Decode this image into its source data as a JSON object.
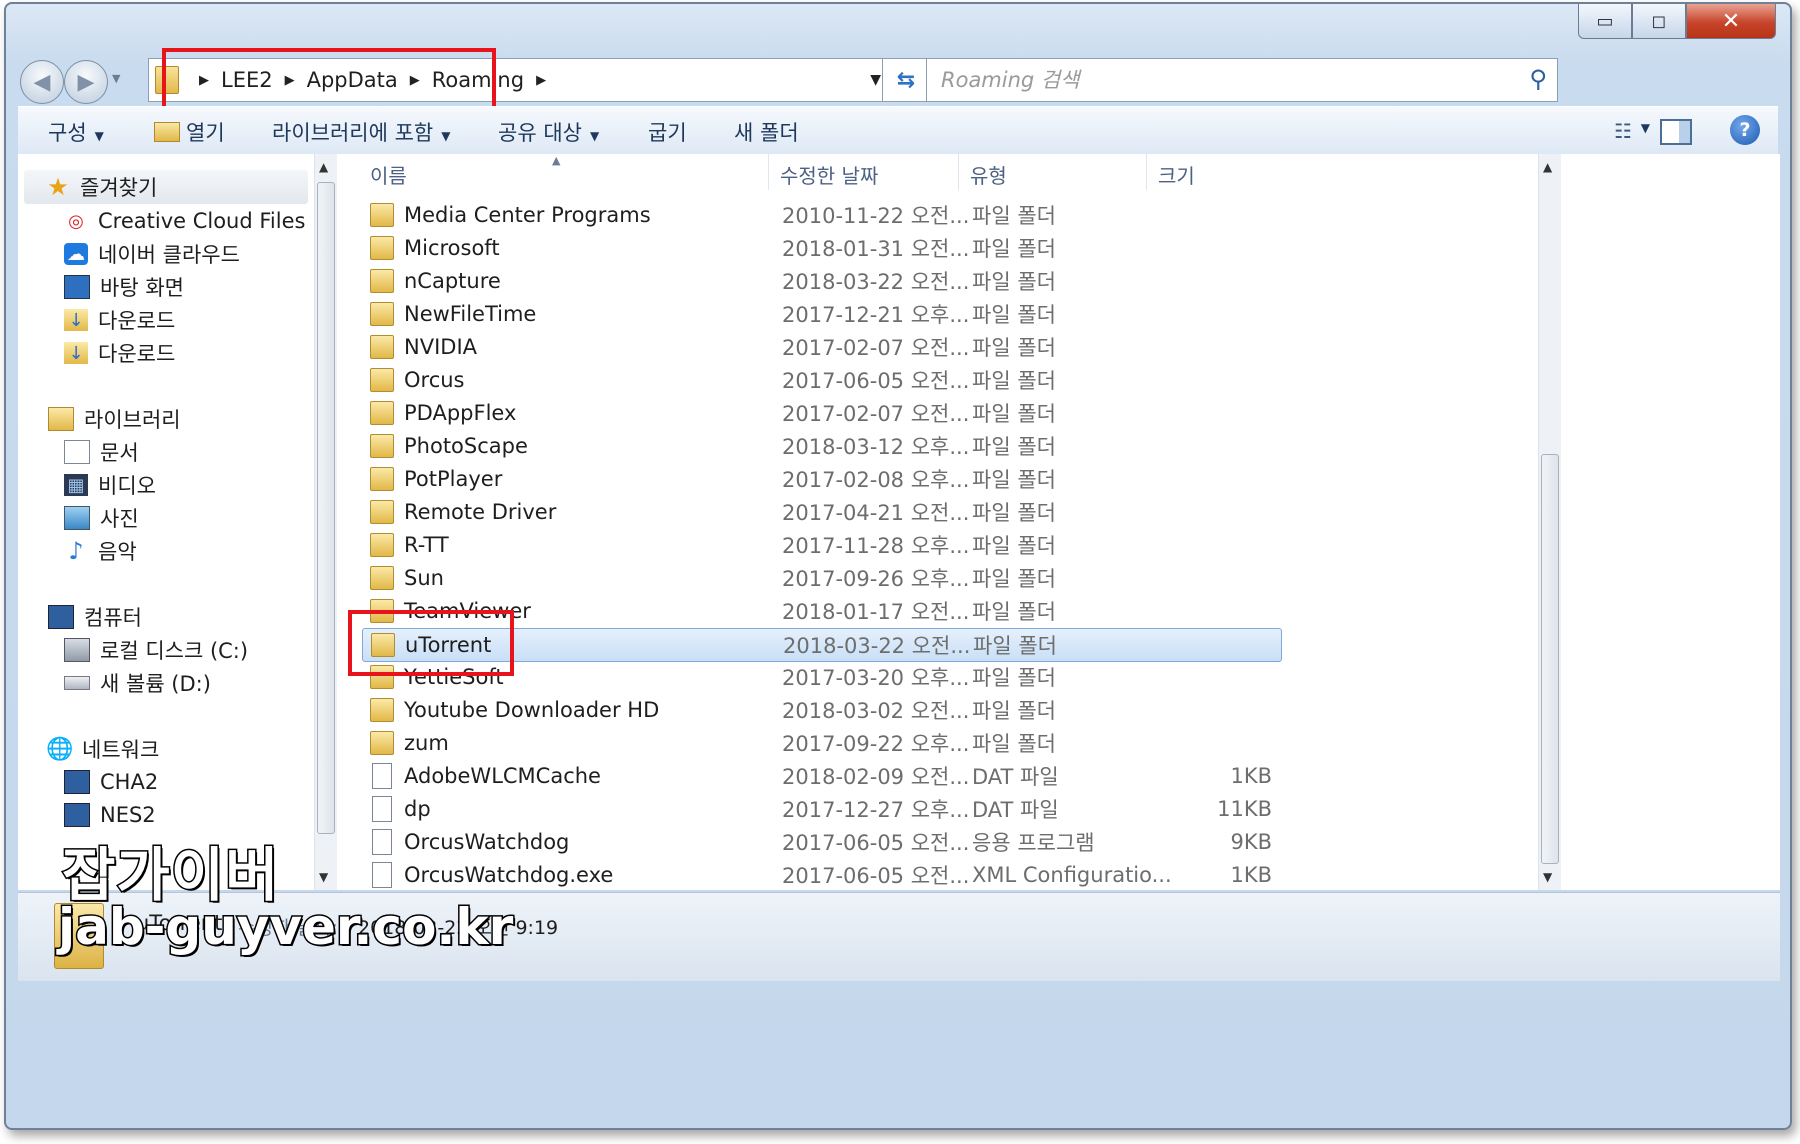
{
  "window": {
    "minimize_glyph": "▭",
    "maximize_glyph": "◻",
    "close_glyph": "✕"
  },
  "address": {
    "crumbs": [
      "LEE2",
      "AppData",
      "Roaming"
    ]
  },
  "search": {
    "placeholder": "Roaming 검색"
  },
  "toolbar": {
    "organize": "구성",
    "open": "열기",
    "include_library": "라이브러리에 포함",
    "share_with": "공유 대상",
    "burn": "굽기",
    "new_folder": "새 폴더"
  },
  "nav": {
    "favorites": {
      "label": "즐겨찾기",
      "items": [
        "Creative Cloud Files",
        "네이버 클라우드",
        "바탕 화면",
        "다운로드",
        "다운로드"
      ]
    },
    "libraries": {
      "label": "라이브러리",
      "items": [
        "문서",
        "비디오",
        "사진",
        "음악"
      ]
    },
    "computer": {
      "label": "컴퓨터",
      "items": [
        "로컬 디스크 (C:)",
        "새 볼륨 (D:)"
      ]
    },
    "network": {
      "label": "네트워크",
      "items": [
        "CHA2",
        "NES2"
      ]
    }
  },
  "columns": {
    "name": "이름",
    "date": "수정한 날짜",
    "type": "유형",
    "size": "크기"
  },
  "files": [
    {
      "name": "Media Center Programs",
      "date": "2010-11-22 오전...",
      "type": "파일 폴더",
      "size": "",
      "kind": "folder"
    },
    {
      "name": "Microsoft",
      "date": "2018-01-31 오전...",
      "type": "파일 폴더",
      "size": "",
      "kind": "folder"
    },
    {
      "name": "nCapture",
      "date": "2018-03-22 오전...",
      "type": "파일 폴더",
      "size": "",
      "kind": "folder"
    },
    {
      "name": "NewFileTime",
      "date": "2017-12-21 오후...",
      "type": "파일 폴더",
      "size": "",
      "kind": "folder"
    },
    {
      "name": "NVIDIA",
      "date": "2017-02-07 오전...",
      "type": "파일 폴더",
      "size": "",
      "kind": "folder"
    },
    {
      "name": "Orcus",
      "date": "2017-06-05 오전...",
      "type": "파일 폴더",
      "size": "",
      "kind": "folder"
    },
    {
      "name": "PDAppFlex",
      "date": "2017-02-07 오전...",
      "type": "파일 폴더",
      "size": "",
      "kind": "folder"
    },
    {
      "name": "PhotoScape",
      "date": "2018-03-12 오후...",
      "type": "파일 폴더",
      "size": "",
      "kind": "folder"
    },
    {
      "name": "PotPlayer",
      "date": "2017-02-08 오후...",
      "type": "파일 폴더",
      "size": "",
      "kind": "folder"
    },
    {
      "name": "Remote Driver",
      "date": "2017-04-21 오전...",
      "type": "파일 폴더",
      "size": "",
      "kind": "folder"
    },
    {
      "name": "R-TT",
      "date": "2017-11-28 오후...",
      "type": "파일 폴더",
      "size": "",
      "kind": "folder"
    },
    {
      "name": "Sun",
      "date": "2017-09-26 오후...",
      "type": "파일 폴더",
      "size": "",
      "kind": "folder"
    },
    {
      "name": "TeamViewer",
      "date": "2018-01-17 오전...",
      "type": "파일 폴더",
      "size": "",
      "kind": "folder"
    },
    {
      "name": "uTorrent",
      "date": "2018-03-22 오전...",
      "type": "파일 폴더",
      "size": "",
      "kind": "folder",
      "selected": true
    },
    {
      "name": "YettieSoft",
      "date": "2017-03-20 오후...",
      "type": "파일 폴더",
      "size": "",
      "kind": "folder"
    },
    {
      "name": "Youtube Downloader HD",
      "date": "2018-03-02 오전...",
      "type": "파일 폴더",
      "size": "",
      "kind": "folder"
    },
    {
      "name": "zum",
      "date": "2017-09-22 오후...",
      "type": "파일 폴더",
      "size": "",
      "kind": "folder"
    },
    {
      "name": "AdobeWLCMCache",
      "date": "2018-02-09 오전...",
      "type": "DAT 파일",
      "size": "1KB",
      "kind": "file"
    },
    {
      "name": "dp",
      "date": "2017-12-27 오후...",
      "type": "DAT 파일",
      "size": "11KB",
      "kind": "file"
    },
    {
      "name": "OrcusWatchdog",
      "date": "2017-06-05 오전...",
      "type": "응용 프로그램",
      "size": "9KB",
      "kind": "file"
    },
    {
      "name": "OrcusWatchdog.exe",
      "date": "2017-06-05 오전...",
      "type": "XML Configuratio...",
      "size": "1KB",
      "kind": "file"
    }
  ],
  "status": {
    "name": "uTorrent",
    "label": "수정한 날짜:",
    "value": "2018-03-22 오전 9:19"
  },
  "watermark": {
    "line1": "잡가이버",
    "line2": "jab-guyver.co.kr"
  },
  "colors": {
    "highlight_box": "#e8141c",
    "selection": "#c9dff7"
  }
}
